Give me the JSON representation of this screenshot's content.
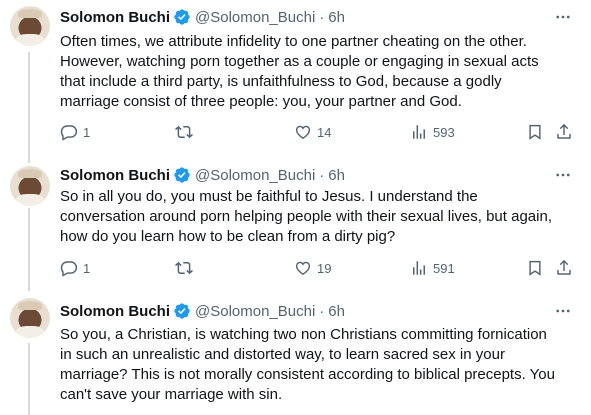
{
  "colors": {
    "verified_blue": "#1d9bf0",
    "text_primary": "#0f1419",
    "text_secondary": "#536471",
    "thread_line": "#cfd9de"
  },
  "tweets": [
    {
      "author": "Solomon Buchi",
      "handle": "@Solomon_Buchi",
      "separator": "·",
      "time": "6h",
      "verified_icon": "verified-badge-icon",
      "text_lines": [
        "Often times, we attribute infidelity to one partner cheating on the other.",
        "However, watching porn together as a couple or engaging in sexual acts",
        "that include a third party, is unfaithfulness to God, because a godly",
        "marriage consist of three people: you, your partner and God."
      ],
      "replies": "1",
      "retweets": "",
      "likes": "14",
      "views": "593"
    },
    {
      "author": "Solomon Buchi",
      "handle": "@Solomon_Buchi",
      "separator": "·",
      "time": "6h",
      "verified_icon": "verified-badge-icon",
      "text_lines": [
        "So in all you do, you must be faithful to Jesus. I understand the",
        "conversation around porn helping people with their sexual lives, but again,",
        "how do you learn how to be clean from a dirty pig?"
      ],
      "replies": "1",
      "retweets": "",
      "likes": "19",
      "views": "591"
    },
    {
      "author": "Solomon Buchi",
      "handle": "@Solomon_Buchi",
      "separator": "·",
      "time": "6h",
      "verified_icon": "verified-badge-icon",
      "text_lines": [
        "So you, a Christian, is watching two non Christians committing fornication",
        "in such an unrealistic and distorted way, to learn sacred sex in your",
        "marriage? This is not morally consistent according to biblical precepts. You",
        "can't save your marriage with sin."
      ]
    }
  ]
}
